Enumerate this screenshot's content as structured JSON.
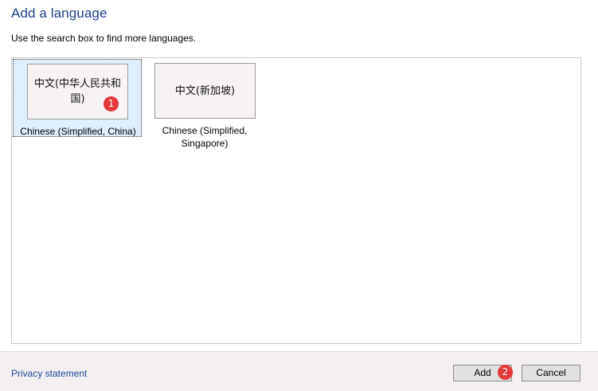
{
  "dialog": {
    "title": "Add a language",
    "instructions": "Use the search box to find more languages."
  },
  "languages": [
    {
      "native": "中文(中华人民共和国)",
      "label": "Chinese (Simplified, China)",
      "selected": true,
      "badge": "1"
    },
    {
      "native": "中文(新加坡)",
      "label": "Chinese (Simplified, Singapore)",
      "selected": false
    }
  ],
  "footer": {
    "privacy_link": "Privacy statement",
    "add_label": "Add",
    "add_badge": "2",
    "cancel_label": "Cancel"
  },
  "colors": {
    "title": "#1d3f8a",
    "selection": "#dfeefb",
    "badge": "#e53a3a",
    "footer_bg": "#f3eff0",
    "link": "#1d4a9c"
  }
}
